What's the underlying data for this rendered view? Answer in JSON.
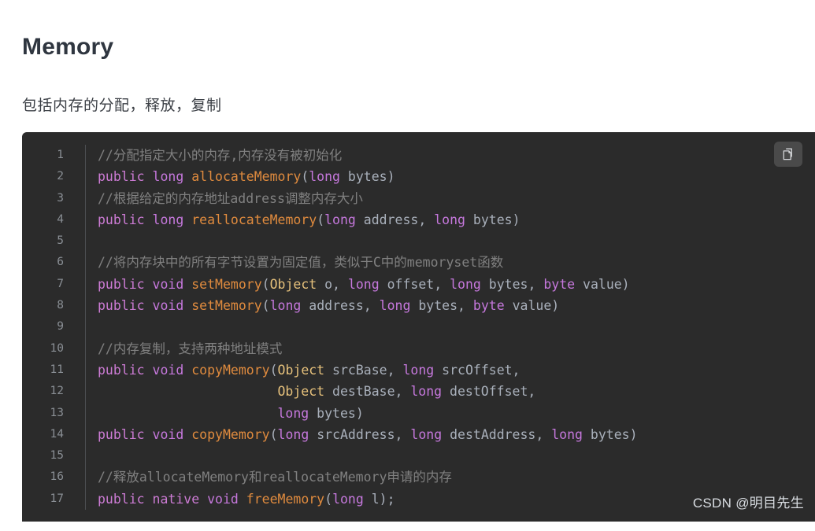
{
  "page": {
    "title": "Memory",
    "subtitle": "包括内存的分配，释放，复制",
    "watermark": "CSDN @明目先生",
    "title_color": "#2f3640",
    "code_background": "#2b2b2b",
    "line_number_color": "#8a8f95"
  },
  "toolbar": {
    "copy_label": "copy-code",
    "copy_icon": "copy-icon"
  },
  "code": {
    "language": "java",
    "line_numbers": [
      "1",
      "2",
      "3",
      "4",
      "5",
      "6",
      "7",
      "8",
      "9",
      "10",
      "11",
      "12",
      "13",
      "14",
      "15",
      "16",
      "17"
    ],
    "lines": [
      {
        "n": "1",
        "plain": "//分配指定大小的内存,内存没有被初始化"
      },
      {
        "n": "2",
        "plain": "public long allocateMemory(long bytes)"
      },
      {
        "n": "3",
        "plain": "//根据给定的内存地址address调整内存大小"
      },
      {
        "n": "4",
        "plain": "public long reallocateMemory(long address, long bytes)"
      },
      {
        "n": "5",
        "plain": ""
      },
      {
        "n": "6",
        "plain": "//将内存块中的所有字节设置为固定值，类似于C中的memoryset函数"
      },
      {
        "n": "7",
        "plain": "public void setMemory(Object o, long offset, long bytes, byte value)"
      },
      {
        "n": "8",
        "plain": "public void setMemory(long address, long bytes, byte value)"
      },
      {
        "n": "9",
        "plain": ""
      },
      {
        "n": "10",
        "plain": "//内存复制，支持两种地址模式"
      },
      {
        "n": "11",
        "plain": "public void copyMemory(Object srcBase, long srcOffset,"
      },
      {
        "n": "12",
        "plain": "                       Object destBase, long destOffset,"
      },
      {
        "n": "13",
        "plain": "                       long bytes)"
      },
      {
        "n": "14",
        "plain": "public void copyMemory(long srcAddress, long destAddress, long bytes)"
      },
      {
        "n": "15",
        "plain": ""
      },
      {
        "n": "16",
        "plain": "//释放allocateMemory和reallocateMemory申请的内存"
      },
      {
        "n": "17",
        "plain": "public native void freeMemory(long l);"
      }
    ],
    "tokens": [
      [
        {
          "t": "//分配指定大小的内存,内存没有被初始化",
          "c": "comment"
        }
      ],
      [
        {
          "t": "public",
          "c": "keyword"
        },
        {
          "t": " ",
          "c": "punct"
        },
        {
          "t": "long",
          "c": "type"
        },
        {
          "t": " ",
          "c": "punct"
        },
        {
          "t": "allocateMemory",
          "c": "fn"
        },
        {
          "t": "(",
          "c": "punct"
        },
        {
          "t": "long",
          "c": "type"
        },
        {
          "t": " bytes)",
          "c": "ident"
        }
      ],
      [
        {
          "t": "//根据给定的内存地址address调整内存大小",
          "c": "comment"
        }
      ],
      [
        {
          "t": "public",
          "c": "keyword"
        },
        {
          "t": " ",
          "c": "punct"
        },
        {
          "t": "long",
          "c": "type"
        },
        {
          "t": " ",
          "c": "punct"
        },
        {
          "t": "reallocateMemory",
          "c": "fn"
        },
        {
          "t": "(",
          "c": "punct"
        },
        {
          "t": "long",
          "c": "type"
        },
        {
          "t": " address, ",
          "c": "ident"
        },
        {
          "t": "long",
          "c": "type"
        },
        {
          "t": " bytes)",
          "c": "ident"
        }
      ],
      [
        {
          "t": "",
          "c": "ident"
        }
      ],
      [
        {
          "t": "//将内存块中的所有字节设置为固定值，类似于C中的memoryset函数",
          "c": "comment"
        }
      ],
      [
        {
          "t": "public",
          "c": "keyword"
        },
        {
          "t": " ",
          "c": "punct"
        },
        {
          "t": "void",
          "c": "type"
        },
        {
          "t": " ",
          "c": "punct"
        },
        {
          "t": "setMemory",
          "c": "fn"
        },
        {
          "t": "(",
          "c": "punct"
        },
        {
          "t": "Object",
          "c": "class"
        },
        {
          "t": " o, ",
          "c": "ident"
        },
        {
          "t": "long",
          "c": "type"
        },
        {
          "t": " offset, ",
          "c": "ident"
        },
        {
          "t": "long",
          "c": "type"
        },
        {
          "t": " bytes, ",
          "c": "ident"
        },
        {
          "t": "byte",
          "c": "type"
        },
        {
          "t": " value)",
          "c": "ident"
        }
      ],
      [
        {
          "t": "public",
          "c": "keyword"
        },
        {
          "t": " ",
          "c": "punct"
        },
        {
          "t": "void",
          "c": "type"
        },
        {
          "t": " ",
          "c": "punct"
        },
        {
          "t": "setMemory",
          "c": "fn"
        },
        {
          "t": "(",
          "c": "punct"
        },
        {
          "t": "long",
          "c": "type"
        },
        {
          "t": " address, ",
          "c": "ident"
        },
        {
          "t": "long",
          "c": "type"
        },
        {
          "t": " bytes, ",
          "c": "ident"
        },
        {
          "t": "byte",
          "c": "type"
        },
        {
          "t": " value)",
          "c": "ident"
        }
      ],
      [
        {
          "t": "",
          "c": "ident"
        }
      ],
      [
        {
          "t": "//内存复制，支持两种地址模式",
          "c": "comment"
        }
      ],
      [
        {
          "t": "public",
          "c": "keyword"
        },
        {
          "t": " ",
          "c": "punct"
        },
        {
          "t": "void",
          "c": "type"
        },
        {
          "t": " ",
          "c": "punct"
        },
        {
          "t": "copyMemory",
          "c": "fn"
        },
        {
          "t": "(",
          "c": "punct"
        },
        {
          "t": "Object",
          "c": "class"
        },
        {
          "t": " srcBase, ",
          "c": "ident"
        },
        {
          "t": "long",
          "c": "type"
        },
        {
          "t": " srcOffset,",
          "c": "ident"
        }
      ],
      [
        {
          "t": "                       ",
          "c": "punct"
        },
        {
          "t": "Object",
          "c": "class"
        },
        {
          "t": " destBase, ",
          "c": "ident"
        },
        {
          "t": "long",
          "c": "type"
        },
        {
          "t": " destOffset,",
          "c": "ident"
        }
      ],
      [
        {
          "t": "                       ",
          "c": "punct"
        },
        {
          "t": "long",
          "c": "type"
        },
        {
          "t": " bytes)",
          "c": "ident"
        }
      ],
      [
        {
          "t": "public",
          "c": "keyword"
        },
        {
          "t": " ",
          "c": "punct"
        },
        {
          "t": "void",
          "c": "type"
        },
        {
          "t": " ",
          "c": "punct"
        },
        {
          "t": "copyMemory",
          "c": "fn"
        },
        {
          "t": "(",
          "c": "punct"
        },
        {
          "t": "long",
          "c": "type"
        },
        {
          "t": " srcAddress, ",
          "c": "ident"
        },
        {
          "t": "long",
          "c": "type"
        },
        {
          "t": " destAddress, ",
          "c": "ident"
        },
        {
          "t": "long",
          "c": "type"
        },
        {
          "t": " bytes)",
          "c": "ident"
        }
      ],
      [
        {
          "t": "",
          "c": "ident"
        }
      ],
      [
        {
          "t": "//释放allocateMemory和reallocateMemory申请的内存",
          "c": "comment"
        }
      ],
      [
        {
          "t": "public",
          "c": "keyword"
        },
        {
          "t": " ",
          "c": "punct"
        },
        {
          "t": "native",
          "c": "keyword"
        },
        {
          "t": " ",
          "c": "punct"
        },
        {
          "t": "void",
          "c": "type"
        },
        {
          "t": " ",
          "c": "punct"
        },
        {
          "t": "freeMemory",
          "c": "fn"
        },
        {
          "t": "(",
          "c": "punct"
        },
        {
          "t": "long",
          "c": "type"
        },
        {
          "t": " l);",
          "c": "ident"
        }
      ]
    ]
  },
  "colors": {
    "comment": "#808080",
    "keyword": "#cc7bd4",
    "type": "#c678dd",
    "function": "#e08b3e",
    "class": "#e5c07b",
    "identifier": "#a9b0bb"
  }
}
